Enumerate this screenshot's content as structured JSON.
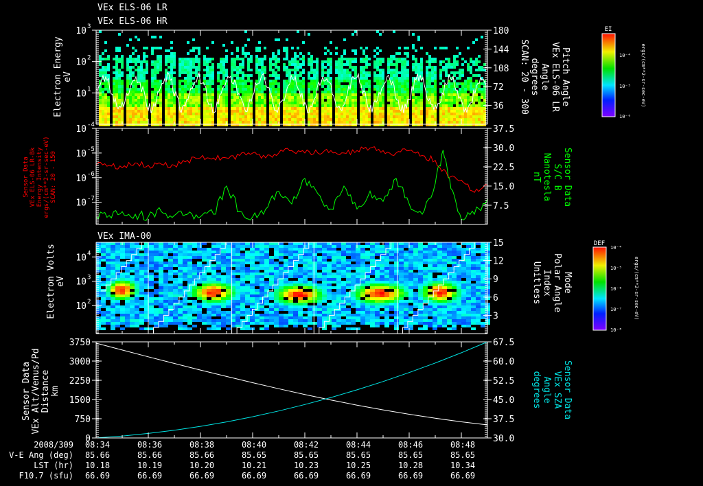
{
  "chart_data": {
    "type": "multi-panel",
    "time_range": [
      "08:34",
      "08:49"
    ],
    "x_ticks": [
      "08:34",
      "08:36",
      "08:38",
      "08:40",
      "08:42",
      "08:44",
      "08:46",
      "08:48"
    ],
    "panels": [
      {
        "type": "heatmap",
        "titles": [
          "VEx ELS-06 LR",
          "VEx ELS-06 HR"
        ],
        "ylabel": [
          "Electron Energy",
          "eV"
        ],
        "yscale": "log",
        "ylim_log10": [
          0,
          3
        ],
        "y_ticks": [
          {
            "base": "10",
            "exp": "3"
          },
          {
            "base": "10",
            "exp": "2"
          },
          {
            "base": "10",
            "exp": "1"
          }
        ],
        "right_label": [
          "Pitch Angle",
          "VEx ELS-06 LR",
          "Angle",
          "degrees",
          "SCAN: 20 - 300"
        ],
        "right_ticks": [
          "180",
          "144",
          "108",
          "72",
          "36"
        ],
        "right_ylim": [
          0,
          180
        ],
        "colorbar": {
          "title": "EI",
          "ticks": [
            "10⁻⁴",
            "10⁻⁵",
            "10⁻⁶"
          ],
          "units": "ergs/(cm**2-sr-sec-eV)"
        }
      },
      {
        "type": "line",
        "ylabel": [
          "Sensor Data",
          "VEx ELS-06 LR-Bk",
          "Energy Intensity",
          "ergs/(cm**2-sr-sec-eV)",
          "SCAN: 20 - 150"
        ],
        "y_ticks": [
          {
            "base": "10",
            "exp": "-4"
          },
          {
            "base": "10",
            "exp": "-5"
          },
          {
            "base": "10",
            "exp": "-6"
          },
          {
            "base": "10",
            "exp": "-7"
          }
        ],
        "ylim_log10": [
          -7.9,
          -4
        ],
        "right_label": [
          "Sensor Data",
          "S/C B",
          "Nanotesla",
          "nT"
        ],
        "right_ticks": [
          "37.5",
          "30.0",
          "22.5",
          "15.0",
          "7.5"
        ],
        "right_ylim": [
          0,
          37.5
        ],
        "series": [
          {
            "name": "Energy Intensity (log10)",
            "color": "#ff0000",
            "axis": "left",
            "t_min": [
              0,
              0.5,
              1,
              1.5,
              2,
              2.5,
              3,
              3.5,
              4,
              4.5,
              5,
              5.5,
              6,
              6.5,
              7,
              7.5,
              8,
              8.5,
              9,
              9.5,
              10,
              10.5,
              11,
              11.5,
              12,
              12.5,
              13,
              13.5,
              14,
              14.5,
              15
            ],
            "values": [
              -5.5,
              -5.5,
              -5.6,
              -5.4,
              -5.5,
              -5.45,
              -5.5,
              -5.3,
              -5.2,
              -5.2,
              -5.2,
              -5.1,
              -5.0,
              -5.2,
              -5.0,
              -4.9,
              -5.0,
              -5.0,
              -4.9,
              -5.0,
              -4.9,
              -4.8,
              -4.9,
              -5.0,
              -4.9,
              -5.1,
              -5.3,
              -6.0,
              -6.1,
              -6.6,
              -6.3
            ]
          },
          {
            "name": "S/C B (nT)",
            "color": "#00ff00",
            "axis": "right",
            "t_min": [
              0,
              0.5,
              1,
              1.5,
              2,
              2.5,
              3,
              3.5,
              4,
              4.5,
              5,
              5.5,
              6,
              6.5,
              7,
              7.5,
              8,
              8.5,
              9,
              9.5,
              10,
              10.5,
              11,
              11.5,
              12,
              12.5,
              13,
              13.3,
              13.6,
              14,
              14.5,
              15
            ],
            "values": [
              3,
              3.5,
              5,
              4,
              3,
              5,
              3.5,
              4,
              3,
              4,
              15,
              5,
              3,
              6,
              13,
              8,
              18,
              12,
              6,
              15,
              6,
              13,
              9,
              18,
              8,
              4,
              16,
              29,
              14,
              2,
              4,
              10
            ]
          }
        ]
      },
      {
        "type": "heatmap",
        "titles": [
          "VEx IMA-00"
        ],
        "ylabel": [
          "Electron Volts",
          "eV"
        ],
        "yscale": "log",
        "ylim_log10": [
          0.85,
          4.6
        ],
        "y_ticks": [
          {
            "base": "10",
            "exp": "4"
          },
          {
            "base": "10",
            "exp": "3"
          },
          {
            "base": "10",
            "exp": "2"
          }
        ],
        "right_label": [
          "Mode",
          "Polar Angle",
          "Index",
          "Unitless"
        ],
        "right_ticks": [
          "15",
          "12",
          "9",
          "6",
          "3"
        ],
        "right_ylim": [
          0,
          15
        ],
        "colorbar": {
          "title": "DEF",
          "ticks": [
            "10⁻⁴",
            "10⁻⁵",
            "10⁻⁶",
            "10⁻⁷",
            "10⁻⁸"
          ],
          "units": "ergs/(cm**2-sr-sec-eV)"
        }
      },
      {
        "type": "line",
        "ylabel": [
          "Sensor Data",
          "VEx Alt/Venus/Pd",
          "Distance",
          "km"
        ],
        "y_ticks": [
          "3750",
          "3000",
          "2250",
          "1500",
          "750",
          "0"
        ],
        "ylim": [
          0,
          3750
        ],
        "right_label": [
          "Sensor Data",
          "VEx SZA",
          "Angle",
          "degrees"
        ],
        "right_ticks": [
          "67.5",
          "60.0",
          "52.5",
          "45.0",
          "37.5",
          "30.0"
        ],
        "right_ylim": [
          30,
          67.5
        ],
        "series": [
          {
            "name": "Altitude (km)",
            "color": "#ffffff",
            "axis": "left",
            "t_min": [
              0,
              1,
              2,
              3,
              4,
              5,
              6,
              7,
              8,
              9,
              10,
              11,
              12,
              13,
              14,
              15
            ],
            "values": [
              3700,
              3430,
              3165,
              2905,
              2650,
              2400,
              2155,
              1920,
              1695,
              1480,
              1280,
              1095,
              925,
              770,
              630,
              510
            ]
          },
          {
            "name": "SZA (deg)",
            "color": "#00e5e5",
            "axis": "right",
            "t_min": [
              0,
              1,
              2,
              3,
              4,
              5,
              6,
              7,
              8,
              9,
              10,
              11,
              12,
              13,
              14,
              15
            ],
            "values": [
              30,
              30.76,
              31.77,
              33.02,
              34.53,
              36.28,
              38.28,
              40.54,
              43.04,
              45.78,
              48.78,
              52.02,
              55.52,
              59.26,
              63.25,
              67.5
            ]
          }
        ]
      }
    ],
    "table": {
      "rows": [
        {
          "label": "2008/309",
          "values": [
            "08:34",
            "08:36",
            "08:38",
            "08:40",
            "08:42",
            "08:44",
            "08:46",
            "08:48"
          ]
        },
        {
          "label": "V-E Ang (deg)",
          "values": [
            "85.66",
            "85.66",
            "85.66",
            "85.65",
            "85.65",
            "85.65",
            "85.65",
            "85.65"
          ]
        },
        {
          "label": "LST (hr)",
          "values": [
            "10.18",
            "10.19",
            "10.20",
            "10.21",
            "10.23",
            "10.25",
            "10.28",
            "10.34"
          ]
        },
        {
          "label": "F10.7 (sfu)",
          "values": [
            "66.69",
            "66.69",
            "66.69",
            "66.69",
            "66.69",
            "66.69",
            "66.69",
            "66.69"
          ]
        }
      ]
    }
  }
}
